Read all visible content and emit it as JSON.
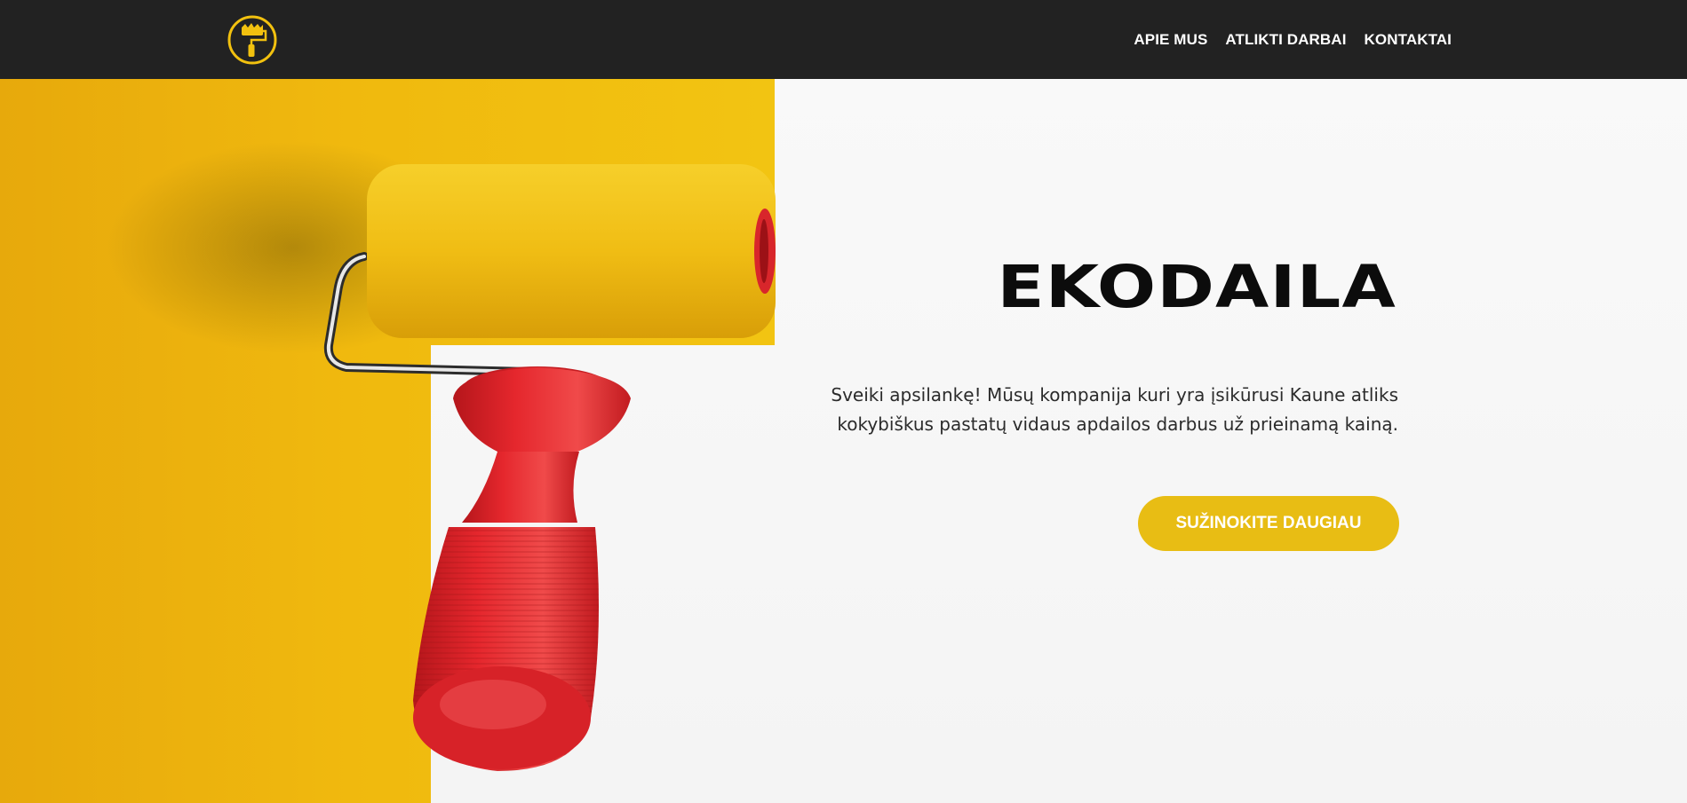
{
  "header": {
    "logo_icon": "paint-roller-logo-icon",
    "nav": [
      {
        "label": "APIE MUS"
      },
      {
        "label": "ATLIKTI DARBAI"
      },
      {
        "label": "KONTAKTAI"
      }
    ]
  },
  "hero": {
    "title": "EKODAILA",
    "intro": "Sveiki apsilankę! Mūsų kompanija kuri yra įsikūrusi Kaune atliks kokybiškus pastatų vidaus apdailos darbus už prieinamą kainą.",
    "cta_label": "SUŽINOKITE DAUGIAU",
    "image": "yellow-paint-roller-on-wall"
  },
  "colors": {
    "header_bg": "#222222",
    "accent": "#e8bd14",
    "roller_yellow": "#f2c10f",
    "handle_red": "#e1262c"
  }
}
